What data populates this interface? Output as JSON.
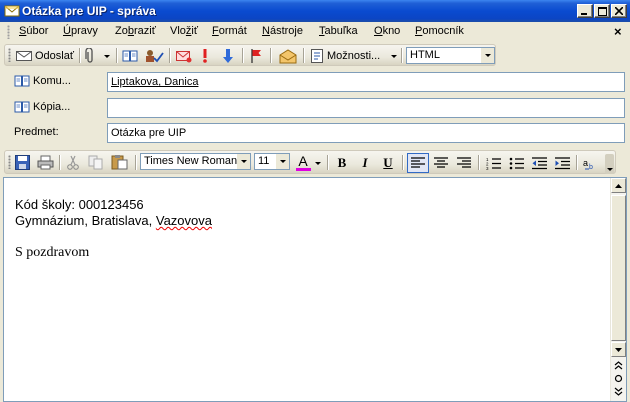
{
  "window": {
    "title": "Otázka pre UIP - správa"
  },
  "menu": [
    {
      "pre": "",
      "u": "S",
      "post": "úbor"
    },
    {
      "pre": "",
      "u": "Ú",
      "post": "pravy"
    },
    {
      "pre": "Zo",
      "u": "b",
      "post": "raziť"
    },
    {
      "pre": "Vlo",
      "u": "ž",
      "post": "iť"
    },
    {
      "pre": "",
      "u": "F",
      "post": "ormát"
    },
    {
      "pre": "",
      "u": "N",
      "post": "ástroje"
    },
    {
      "pre": "",
      "u": "T",
      "post": "abuľka"
    },
    {
      "pre": "",
      "u": "O",
      "post": "kno"
    },
    {
      "pre": "",
      "u": "P",
      "post": "omocník"
    }
  ],
  "toolbar": {
    "send_label": "Odoslať",
    "options_label": "Možnosti...",
    "format_value": "HTML"
  },
  "fields": {
    "to_label": "Komu...",
    "to_value": "Liptakova, Danica",
    "cc_label": "Kópia...",
    "cc_value": "",
    "subject_label": "Predmet:",
    "subject_value": "Otázka pre UIP"
  },
  "formatting": {
    "font_name": "Times New Roman",
    "font_size": "11",
    "bold": "B",
    "italic": "I",
    "underline": "U",
    "font_color_letter": "A"
  },
  "message": {
    "line1": "Kód školy: 000123456",
    "line2_pre": "Gymnázium, Bratislava, ",
    "line2_word": "Vazovova",
    "line3": "S pozdravom"
  },
  "colors": {
    "titlebar": "#0a4bd0",
    "font_color_underline": "#e000e0"
  }
}
